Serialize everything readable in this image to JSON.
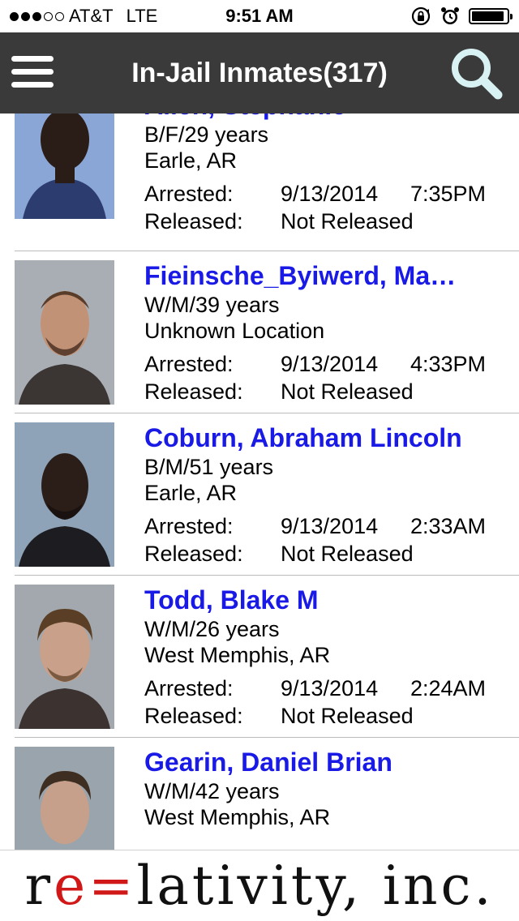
{
  "status_bar": {
    "carrier": "AT&T",
    "network": "LTE",
    "time": "9:51 AM",
    "signal_bars": 3,
    "signal_total": 5,
    "battery_level": 0.92
  },
  "nav": {
    "title": "In-Jail Inmates(317)",
    "menu_icon": "hamburger-menu-icon",
    "search_icon": "search-icon"
  },
  "labels": {
    "arrested": "Arrested:",
    "released": "Released:"
  },
  "inmates": [
    {
      "name": "Allen, Stephanie",
      "demographics": "B/F/29 years",
      "location": "Earle, AR",
      "arrested_date": "9/13/2014",
      "arrested_time": "7:35PM",
      "released": "Not Released"
    },
    {
      "name": "Fieinsche_Byiwerd, Ma…",
      "demographics": "W/M/39 years",
      "location": "Unknown Location",
      "arrested_date": "9/13/2014",
      "arrested_time": "4:33PM",
      "released": "Not Released"
    },
    {
      "name": "Coburn, Abraham Lincoln",
      "demographics": "B/M/51 years",
      "location": "Earle, AR",
      "arrested_date": "9/13/2014",
      "arrested_time": "2:33AM",
      "released": "Not Released"
    },
    {
      "name": "Todd, Blake M",
      "demographics": "W/M/26 years",
      "location": "West Memphis, AR",
      "arrested_date": "9/13/2014",
      "arrested_time": "2:24AM",
      "released": "Not Released"
    },
    {
      "name": "Gearin, Daniel Brian",
      "demographics": "W/M/42 years",
      "location": "West Memphis, AR"
    }
  ],
  "footer": {
    "logo_part1": "r",
    "logo_red": "e=",
    "logo_part2": "lativity, inc."
  },
  "colors": {
    "nav_bg": "#3a3a3a",
    "name_blue": "#1a1ae6",
    "logo_red": "#d01818",
    "mugshot_bg": "#8fa7c4"
  }
}
